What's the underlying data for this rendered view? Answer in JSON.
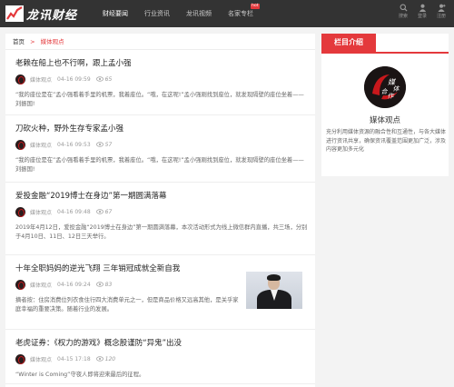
{
  "header": {
    "logo_text": "龙讯财经",
    "nav": [
      {
        "label": "财经要闻",
        "active": true
      },
      {
        "label": "行业资讯",
        "active": false
      },
      {
        "label": "龙讯视频",
        "active": false
      },
      {
        "label": "名家专栏",
        "active": false,
        "badge": "hot"
      }
    ],
    "tools": [
      {
        "label": "搜索",
        "icon": "search-icon"
      },
      {
        "label": "登录",
        "icon": "user-icon"
      },
      {
        "label": "注册",
        "icon": "register-icon"
      }
    ]
  },
  "breadcrumb": {
    "home": "首页",
    "separator": ">",
    "current": "媒体观点"
  },
  "articles": [
    {
      "title": "老赖在船上也不行啊，跟上孟小强",
      "source": "媒体观点",
      "time": "04-16 09:59",
      "views": "65",
      "excerpt": "“我的座位是在”孟小强看着手里的机票，我着座位。“哦，在这呢!”孟小强刚找到座位，就发现隔壁的座位坐着——刘振国!"
    },
    {
      "title": "刀砍火种，野外生存专家孟小强",
      "source": "媒体观点",
      "time": "04-16 09:53",
      "views": "57",
      "excerpt": "“我的座位是在”孟小强看着手里的机票，我着座位。“哦，在这呢!”孟小强刚找到座位，就发现隔壁的座位坐着——刘振国!"
    },
    {
      "title": "爱投金融“2019博士在身边”第一期圆满落幕",
      "source": "媒体观点",
      "time": "04-16 09:48",
      "views": "67",
      "excerpt": "2019年4月12日，爱投金融“2019博士在身边”第一期圆满落幕，本次活动形式为线上微信群内直播，共三场，分别于4月10日、11日、12日三天举行。"
    },
    {
      "title": "十年全职妈妈的逆光飞翔 三年销冠成就全新自我",
      "source": "媒体观点",
      "time": "04-16 09:24",
      "views": "83",
      "excerpt": "摘者按：住房消费位列衣食住行四大消费单元之一，但是商品价格又远高其他，是关乎家庭幸福的重要决策。随着行业的发展。"
    },
    {
      "title": "老虎证券：《权力的游戏》概念股谨防“异鬼”出没",
      "source": "媒体观点",
      "time": "04-15 17:18",
      "views": "120",
      "excerpt": "“Winter is Coming”守夜人即将迎来最后的征程。"
    }
  ],
  "sidebar": {
    "tab_label": "栏目介绍",
    "logo_text": "媒体合作",
    "column_name": "媒体观点",
    "description": "充分利用媒体资源的融合性和互通性，与各大媒体进行资讯共享，确保资讯覆盖范围更加广泛，涉及内容更加多元化"
  },
  "colors": {
    "accent": "#e4393c",
    "header_bg": "#333333"
  }
}
